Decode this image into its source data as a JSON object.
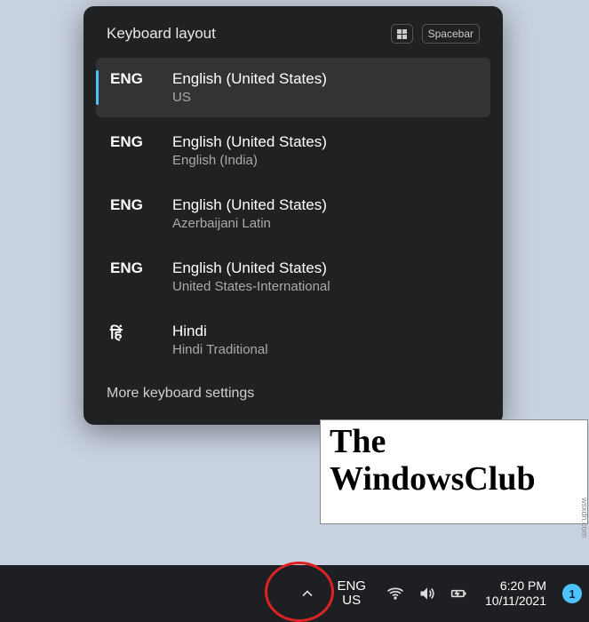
{
  "flyout": {
    "title": "Keyboard layout",
    "shortcut_keys": {
      "win": "win",
      "spacebar": "Spacebar"
    },
    "more_settings": "More keyboard settings",
    "items": [
      {
        "code": "ENG",
        "name": "English (United States)",
        "layout": "US",
        "selected": true
      },
      {
        "code": "ENG",
        "name": "English (United States)",
        "layout": "English (India)",
        "selected": false
      },
      {
        "code": "ENG",
        "name": "English (United States)",
        "layout": "Azerbaijani Latin",
        "selected": false
      },
      {
        "code": "ENG",
        "name": "English (United States)",
        "layout": "United States-International",
        "selected": false
      },
      {
        "code": "हिं",
        "name": "Hindi",
        "layout": "Hindi Traditional",
        "selected": false
      }
    ]
  },
  "taskbar": {
    "lang_indicator": {
      "line1": "ENG",
      "line2": "US"
    },
    "clock": {
      "time": "6:20 PM",
      "date": "10/11/2021"
    },
    "notifications": "1"
  },
  "watermark": {
    "line1": "The",
    "line2": "WindowsClub"
  },
  "attribution": "wsxdn.com"
}
